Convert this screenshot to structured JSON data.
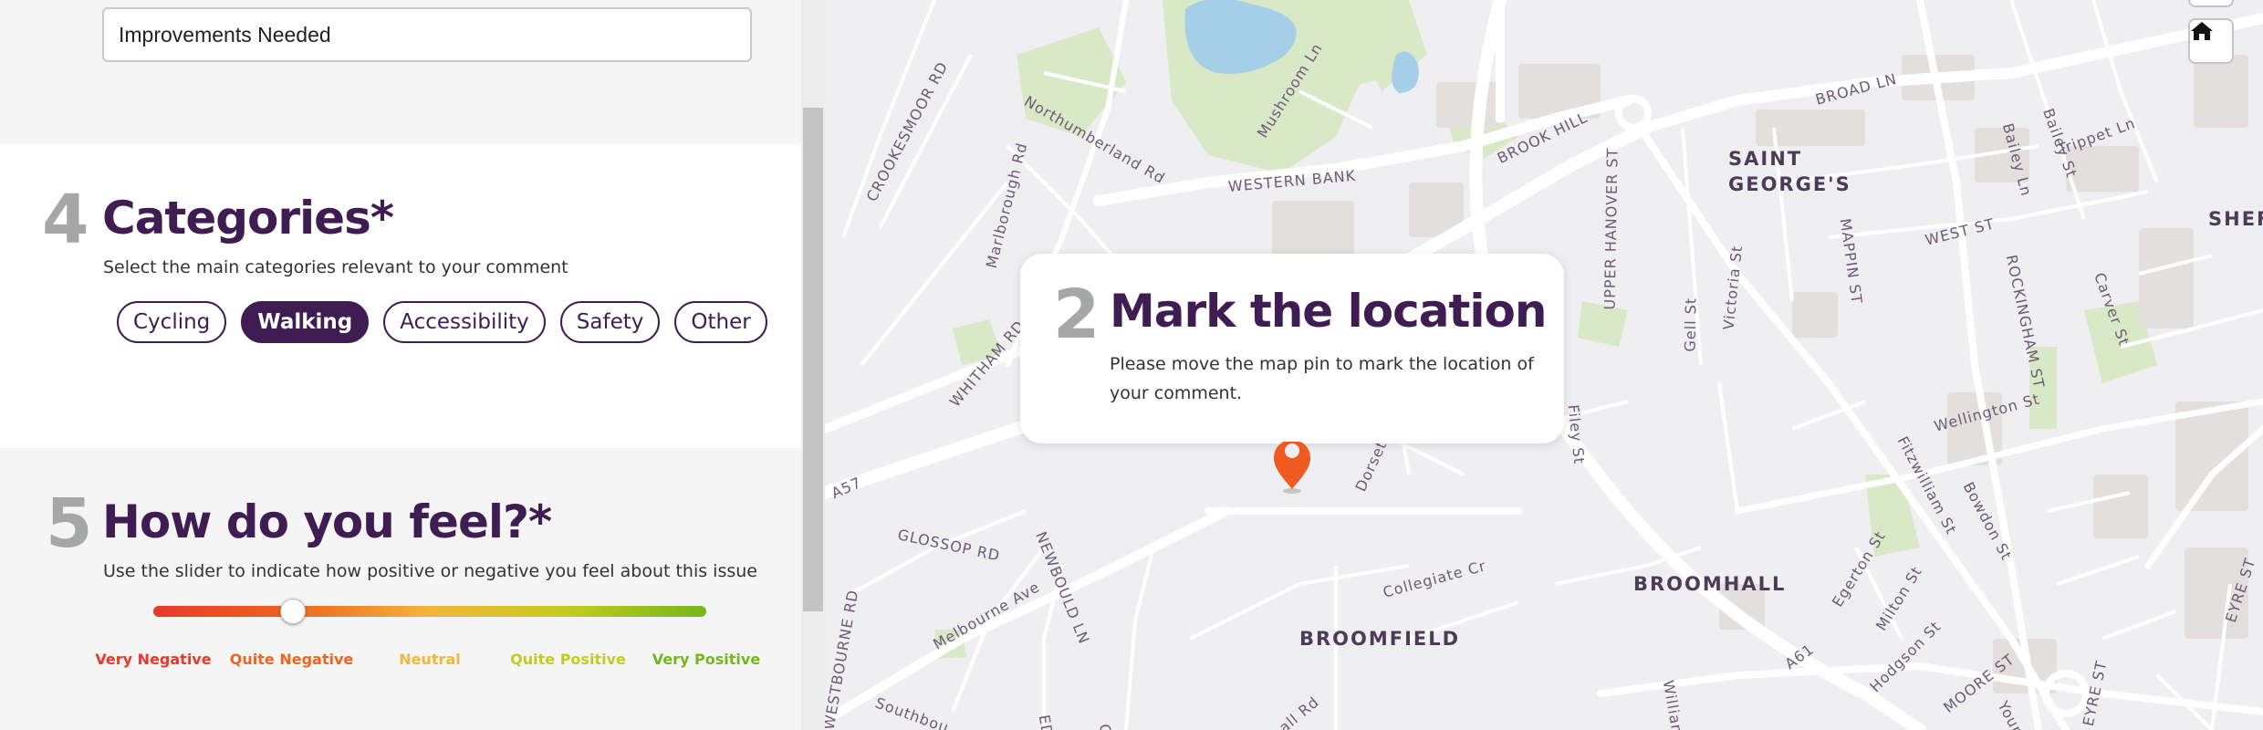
{
  "form": {
    "title_field_value": "Improvements Needed",
    "categories": {
      "step": "4",
      "title": "Categories*",
      "description": "Select the main categories relevant to your comment",
      "options": [
        {
          "label": "Cycling",
          "selected": false
        },
        {
          "label": "Walking",
          "selected": true
        },
        {
          "label": "Accessibility",
          "selected": false
        },
        {
          "label": "Safety",
          "selected": false
        },
        {
          "label": "Other",
          "selected": false
        }
      ]
    },
    "feel": {
      "step": "5",
      "title": "How do you feel?*",
      "description": "Use the slider to indicate how positive or negative you feel about this issue",
      "slider_value_fraction": 0.25,
      "levels": [
        {
          "label": "Very Negative",
          "color": "#e8392b"
        },
        {
          "label": "Quite Negative",
          "color": "#ee6420"
        },
        {
          "label": "Neutral",
          "color": "#f2b63a"
        },
        {
          "label": "Quite Positive",
          "color": "#c2cc1d"
        },
        {
          "label": "Very Positive",
          "color": "#74b61d"
        }
      ]
    }
  },
  "map": {
    "popup": {
      "step": "2",
      "title": "Mark the location",
      "description_line1": "Please move the map pin to mark the location of",
      "description_line2": "your comment."
    },
    "pin_color": "#ee5a1f",
    "home_icon": "home-icon",
    "labels": {
      "crookesmoor": "CROOKESMOOR RD",
      "northumberland": "Northumberland Rd",
      "mushroom": "Mushroom Ln",
      "western_bank": "WESTERN BANK",
      "brook_hill": "BROOK HILL",
      "marlborough": "Marlborough Rd",
      "saint_georges_1": "SAINT",
      "saint_georges_2": "GEORGE'S",
      "broad_ln": "BROAD LN",
      "mappin": "MAPPIN ST",
      "bailey_ln": "Bailey Ln",
      "bailey_st": "Bailey St",
      "trippet": "Trippet Ln",
      "west_st": "WEST ST",
      "rockingham": "ROCKINGHAM ST",
      "carver": "Carver St",
      "shef": "SHEF",
      "upper_hanover": "UPPER HANOVER ST",
      "gell": "Gell St",
      "victoria": "Victoria St",
      "whitham": "WHITHAM RD",
      "a57": "A57",
      "filey": "Filey St",
      "dorset": "Dorset",
      "wellington": "Wellington St",
      "fitzwilliam": "Fitzwilliam St",
      "bowdon": "Bowdon St",
      "glossop": "GLOSSOP RD",
      "newbould": "NEWBOULD LN",
      "melbourne": "Melbourne Ave",
      "collegiate": "Collegiate Cr",
      "broomhall": "BROOMHALL",
      "broomfield": "BROOMFIELD",
      "egerton": "Egerton St",
      "milton": "Milton St",
      "hodgson": "Hodgson St",
      "moore": "MOORE ST",
      "a61": "A61",
      "westbourne": "WESTBOURNE RD",
      "southbourne": "Southbou",
      "william": "William",
      "hall_rd": "all Rd",
      "ed_rd": "ED RD",
      "young": "Young",
      "eyre_st": "EYRE ST",
      "eyre_st2": "EYRE ST",
      "cl": "Cl"
    }
  }
}
